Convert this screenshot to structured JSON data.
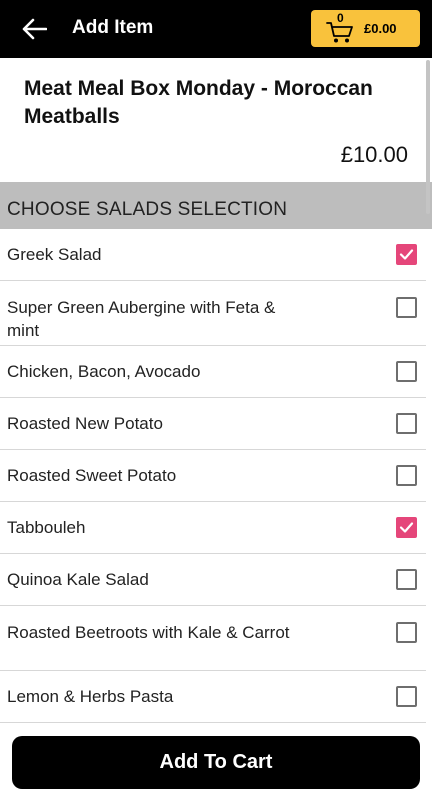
{
  "header": {
    "title": "Add Item",
    "back_icon": "arrow-left-icon",
    "cart": {
      "icon": "cart-icon",
      "count": "0",
      "amount": "£0.00"
    }
  },
  "item": {
    "name": "Meat Meal Box Monday - Moroccan Meatballs",
    "price": "£10.00"
  },
  "section": {
    "title": "CHOOSE SALADS SELECTION"
  },
  "options": [
    {
      "label": "Greek Salad",
      "checked": true
    },
    {
      "label": "Super Green Aubergine with Feta & mint",
      "checked": false
    },
    {
      "label": "Chicken, Bacon, Avocado",
      "checked": false
    },
    {
      "label": "Roasted New Potato",
      "checked": false
    },
    {
      "label": "Roasted Sweet Potato",
      "checked": false
    },
    {
      "label": "Tabbouleh",
      "checked": true
    },
    {
      "label": "Quinoa Kale Salad",
      "checked": false
    },
    {
      "label": "Roasted Beetroots with Kale & Carrot",
      "checked": false
    },
    {
      "label": "Lemon & Herbs Pasta",
      "checked": false
    }
  ],
  "footer": {
    "add_label": "Add To Cart"
  },
  "colors": {
    "accent": "#f9c23c",
    "checked": "#e5467a",
    "bar": "#000000",
    "section_bg": "#bdbdbd"
  }
}
